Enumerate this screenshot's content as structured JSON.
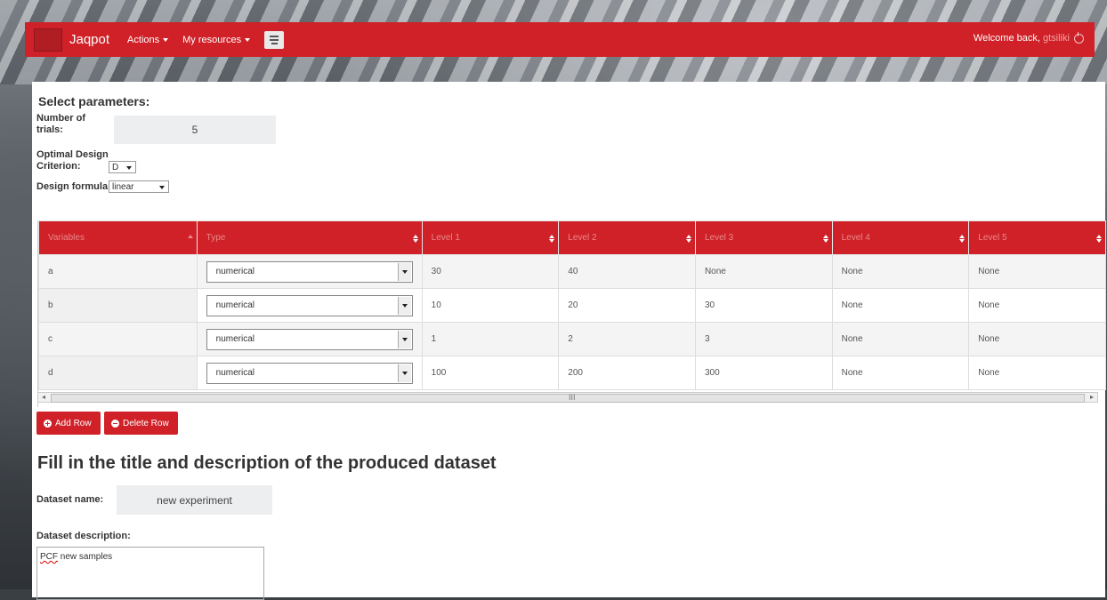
{
  "navbar": {
    "brand": "Jaqpot",
    "actions": "Actions",
    "my_resources": "My resources",
    "welcome": "Welcome back,",
    "username": "gtsiliki"
  },
  "params": {
    "heading": "Select parameters:",
    "trials_label_1": "Number of",
    "trials_label_2": "trials:",
    "trials_value": "5",
    "criterion_label_1": "Optimal Design",
    "criterion_label_2": "Criterion:",
    "criterion_value": "D",
    "formula_label": "Design formula:",
    "formula_value": "linear"
  },
  "table": {
    "headers": [
      "Variables",
      "Type",
      "Level 1",
      "Level 2",
      "Level 3",
      "Level 4",
      "Level 5"
    ],
    "rows": [
      {
        "var": "a",
        "type": "numerical",
        "levels": [
          "30",
          "40",
          "None",
          "None",
          "None"
        ]
      },
      {
        "var": "b",
        "type": "numerical",
        "levels": [
          "10",
          "20",
          "30",
          "None",
          "None"
        ]
      },
      {
        "var": "c",
        "type": "numerical",
        "levels": [
          "1",
          "2",
          "3",
          "None",
          "None"
        ]
      },
      {
        "var": "d",
        "type": "numerical",
        "levels": [
          "100",
          "200",
          "300",
          "None",
          "None"
        ]
      }
    ]
  },
  "scrollbar": {
    "grip": "III",
    "left_arrow": "◂",
    "right_arrow": "▸"
  },
  "buttons": {
    "add_row": "Add Row",
    "delete_row": "Delete Row"
  },
  "dataset": {
    "heading": "Fill in the title and description of the produced dataset",
    "name_label": "Dataset name:",
    "name_value": "new experiment",
    "description_label": "Dataset description:",
    "description_word_1": "PCF",
    "description_rest": " new samples"
  }
}
